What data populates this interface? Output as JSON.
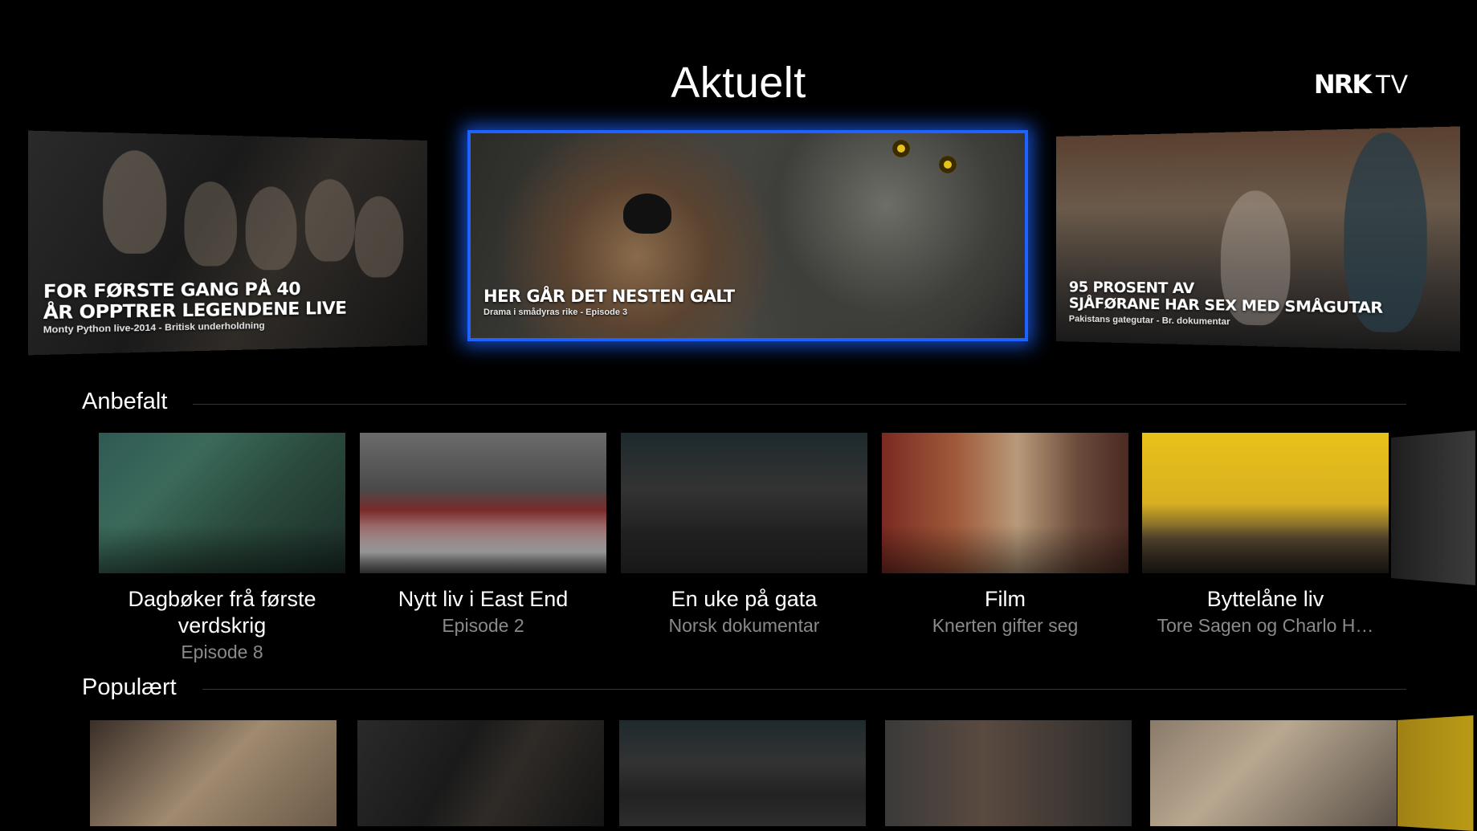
{
  "header": {
    "title": "Aktuelt",
    "logo_mark": "NRK",
    "logo_text": "TV"
  },
  "hero": [
    {
      "headline_1": "FOR FØRSTE GANG PÅ 40",
      "headline_2": "ÅR OPPTRER LEGENDENE LIVE",
      "sub": "Monty Python live-2014 - Britisk underholdning"
    },
    {
      "headline_1": "HER GÅR DET NESTEN GALT",
      "headline_2": "",
      "sub": "Drama i smådyras rike - Episode 3"
    },
    {
      "headline_1": "95 PROSENT AV",
      "headline_2": "SJÅFØRANE HAR SEX MED SMÅGUTAR",
      "sub": "Pakistans gategutar - Br. dokumentar"
    }
  ],
  "rows": {
    "anbefalt": {
      "title": "Anbefalt",
      "items": [
        {
          "title_1": "Dagbøker frå første",
          "title_2": "verdskrig",
          "subtitle": "Episode 8"
        },
        {
          "title_1": "Nytt liv i East End",
          "title_2": "",
          "subtitle": "Episode 2"
        },
        {
          "title_1": "En uke på gata",
          "title_2": "",
          "subtitle": "Norsk dokumentar"
        },
        {
          "title_1": "Film",
          "title_2": "",
          "subtitle": "Knerten gifter seg"
        },
        {
          "title_1": "Byttelåne liv",
          "title_2": "",
          "subtitle": "Tore Sagen og Charlo H…"
        }
      ]
    },
    "populaert": {
      "title": "Populært"
    }
  },
  "colors": {
    "background": "#000000",
    "focus_border": "#1e63ff",
    "subtitle_gray": "#8a8a8a"
  }
}
